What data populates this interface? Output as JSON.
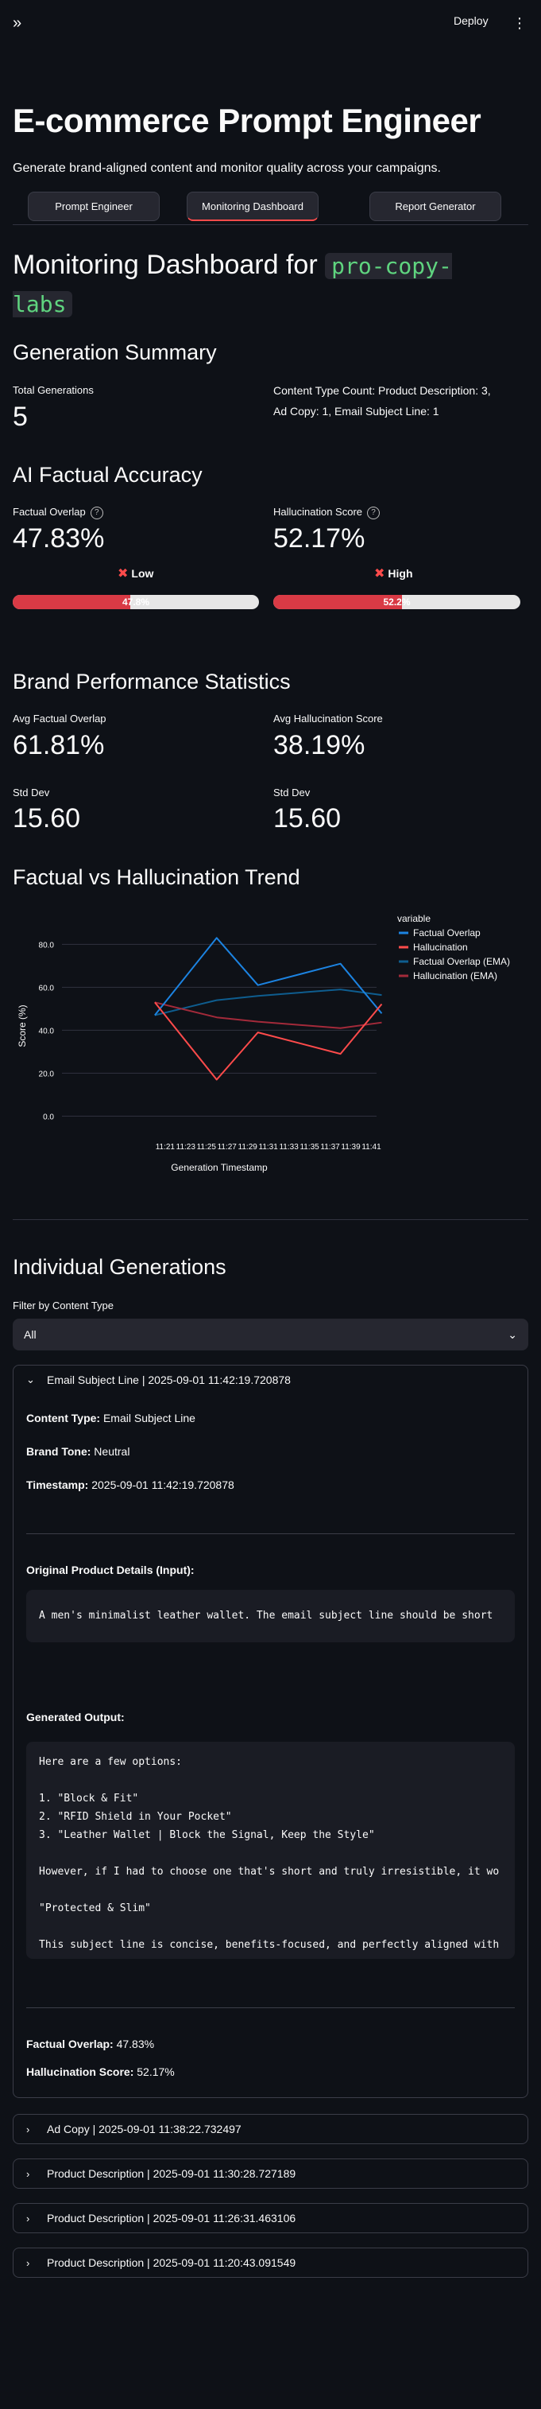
{
  "header": {
    "deploy_label": "Deploy"
  },
  "app": {
    "title": "E-commerce Prompt Engineer",
    "subtitle": "Generate brand-aligned content and monitor quality across your campaigns."
  },
  "tabs": [
    {
      "label": "Prompt Engineer"
    },
    {
      "label": "Monitoring Dashboard"
    },
    {
      "label": "Report Generator"
    }
  ],
  "dashboard": {
    "title_prefix": "Monitoring Dashboard for",
    "brand_code": "pro-copy-labs"
  },
  "generation_summary": {
    "heading": "Generation Summary",
    "total_label": "Total Generations",
    "total_value": "5",
    "content_type_count_line1": "Content Type Count: Product Description: 3,",
    "content_type_count_line2": "Ad Copy: 1, Email Subject Line: 1"
  },
  "accuracy": {
    "heading": "AI Factual Accuracy",
    "factual_label": "Factual Overlap",
    "factual_value": "47.83%",
    "factual_status": "Low",
    "factual_bar_fraction": 0.4783,
    "factual_bar_text": "47.8%",
    "halluc_label": "Hallucination Score",
    "halluc_value": "52.17%",
    "halluc_status": "High",
    "halluc_bar_fraction": 0.5217,
    "halluc_bar_text": "52.2%",
    "status_mark": "✖"
  },
  "brand_stats": {
    "heading": "Brand Performance Statistics",
    "avg_factual_label": "Avg Factual Overlap",
    "avg_factual_value": "61.81%",
    "avg_halluc_label": "Avg Hallucination Score",
    "avg_halluc_value": "38.19%",
    "std_label_left": "Std Dev",
    "std_value_left": "15.60",
    "std_label_right": "Std Dev",
    "std_value_right": "15.60"
  },
  "trend": {
    "heading": "Factual vs Hallucination Trend"
  },
  "chart_data": {
    "type": "line",
    "title": "",
    "xlabel": "Generation Timestamp",
    "ylabel": "Score (%)",
    "x_ticks": [
      "11:21",
      "11:23",
      "11:25",
      "11:27",
      "11:29",
      "11:31",
      "11:33",
      "11:35",
      "11:37",
      "11:39",
      "11:41"
    ],
    "y_ticks": [
      "0.0",
      "20.0",
      "40.0",
      "60.0",
      "80.0"
    ],
    "ylim": [
      -8,
      92
    ],
    "x_minutes_range": [
      11.0,
      41.5
    ],
    "grid": true,
    "legend_title": "variable",
    "legend_position": "right",
    "x": [
      "11:20",
      "11:26",
      "11:30",
      "11:38",
      "11:42"
    ],
    "series": [
      {
        "name": "Factual Overlap",
        "color": "#1c83e1",
        "values": [
          47,
          83,
          61,
          71,
          47.83
        ]
      },
      {
        "name": "Hallucination",
        "color": "#ff4b4b",
        "values": [
          53,
          17,
          39,
          29,
          52.17
        ]
      },
      {
        "name": "Factual Overlap (EMA)",
        "color": "#0e5d8f",
        "values": [
          47,
          54,
          56,
          59,
          56.4
        ]
      },
      {
        "name": "Hallucination (EMA)",
        "color": "#a32a3a",
        "values": [
          53,
          46,
          44,
          41,
          43.6
        ]
      }
    ]
  },
  "individual": {
    "heading": "Individual Generations",
    "filter_label": "Filter by Content Type",
    "filter_value": "All",
    "expanded": {
      "title": "Email Subject Line | 2025-09-01 11:42:19.720878",
      "content_type_label": "Content Type:",
      "content_type_value": "Email Subject Line",
      "brand_tone_label": "Brand Tone:",
      "brand_tone_value": "Neutral",
      "timestamp_label": "Timestamp:",
      "timestamp_value": "2025-09-01 11:42:19.720878",
      "input_heading": "Original Product Details (Input):",
      "input_text": "A men's minimalist leather wallet. The email subject line should be short",
      "output_heading": "Generated Output:",
      "output_lines": [
        "Here are a few options:",
        "",
        "1. \"Block & Fit\"",
        "2. \"RFID Shield in Your Pocket\"",
        "3. \"Leather Wallet | Block the Signal, Keep the Style\"",
        "",
        "However, if I had to choose one that's short and truly irresistible, it wo",
        "",
        "\"Protected & Slim\"",
        "",
        "This subject line is concise, benefits-focused, and perfectly aligned with"
      ],
      "factual_label": "Factual Overlap:",
      "factual_value": "47.83%",
      "halluc_label": "Hallucination Score:",
      "halluc_value": "52.17%"
    },
    "collapsed": [
      {
        "title": "Ad Copy | 2025-09-01 11:38:22.732497"
      },
      {
        "title": "Product Description | 2025-09-01 11:30:28.727189"
      },
      {
        "title": "Product Description | 2025-09-01 11:26:31.463106"
      },
      {
        "title": "Product Description | 2025-09-01 11:20:43.091549"
      }
    ]
  }
}
